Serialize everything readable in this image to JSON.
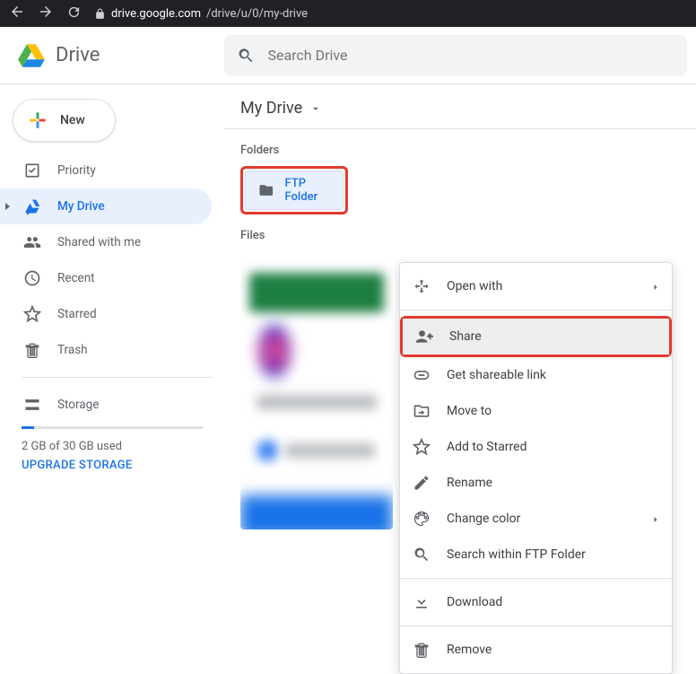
{
  "browser": {
    "url_host": "drive.google.com",
    "url_path": "/drive/u/0/my-drive"
  },
  "header": {
    "product": "Drive",
    "search_placeholder": "Search Drive"
  },
  "newButton": {
    "label": "New"
  },
  "sidebar": {
    "items": [
      {
        "label": "Priority"
      },
      {
        "label": "My Drive"
      },
      {
        "label": "Shared with me"
      },
      {
        "label": "Recent"
      },
      {
        "label": "Starred"
      },
      {
        "label": "Trash"
      }
    ],
    "storage": {
      "title": "Storage",
      "used_text": "2 GB of 30 GB used",
      "upgrade_label": "UPGRADE STORAGE"
    }
  },
  "main": {
    "breadcrumb": "My Drive",
    "folders_label": "Folders",
    "files_label": "Files",
    "folder_name": "FTP Folder"
  },
  "contextMenu": {
    "open_with": "Open with",
    "share": "Share",
    "get_link": "Get shareable link",
    "move_to": "Move to",
    "add_starred": "Add to Starred",
    "rename": "Rename",
    "change_color": "Change color",
    "search_within": "Search within FTP Folder",
    "download": "Download",
    "remove": "Remove"
  }
}
